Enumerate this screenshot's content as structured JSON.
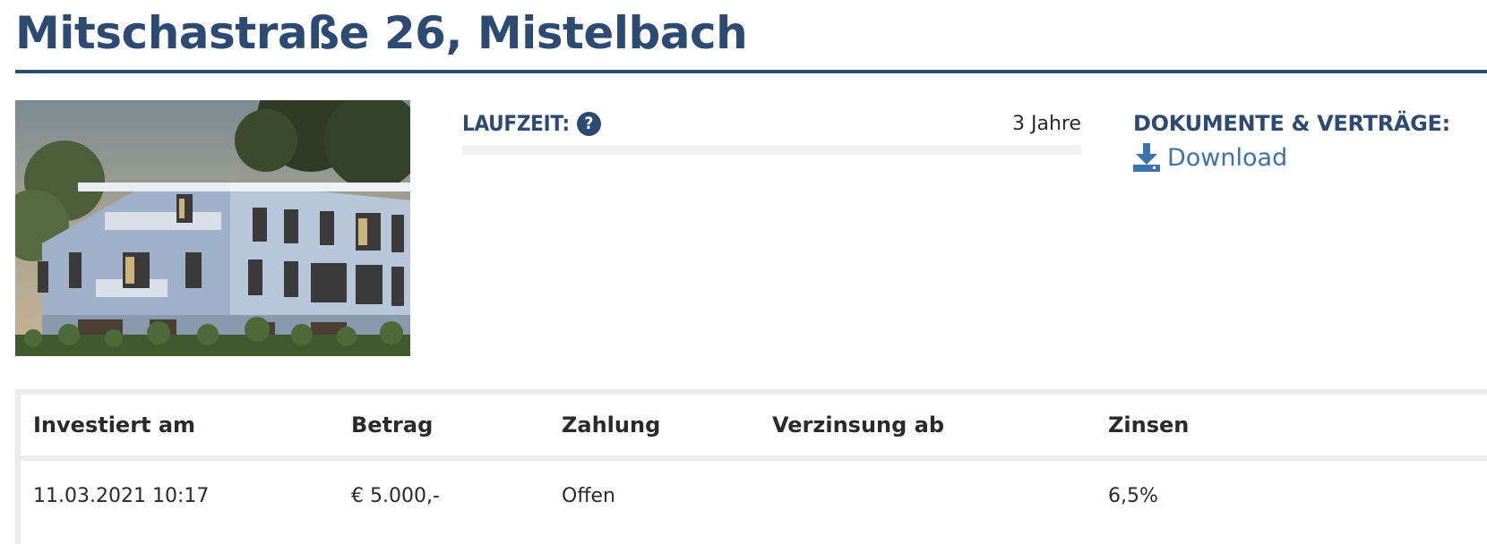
{
  "header": {
    "title": "Mitschastraße 26, Mistelbach"
  },
  "project": {
    "image_alt": "building-rendering",
    "laufzeit_label": "LAUFZEIT:",
    "laufzeit_value": "3 Jahre",
    "laufzeit_progress": 0,
    "help_icon": "question-circle-icon",
    "documents_label": "DOKUMENTE & VERTRÄGE:",
    "download_label": "Download",
    "download_icon": "download-icon"
  },
  "investments": {
    "columns": [
      "Investiert am",
      "Betrag",
      "Zahlung",
      "Verzinsung ab",
      "Zinsen"
    ],
    "rows": [
      {
        "investiert_am": "11.03.2021 10:17",
        "betrag": "€ 5.000,-",
        "zahlung": "Offen",
        "verzinsung_ab": "",
        "zinsen": "6,5%"
      }
    ]
  },
  "colors": {
    "brand": "#2c4a72",
    "link": "#3c72ad",
    "table_border": "#ebebeb",
    "track": "#f1f1f1"
  }
}
